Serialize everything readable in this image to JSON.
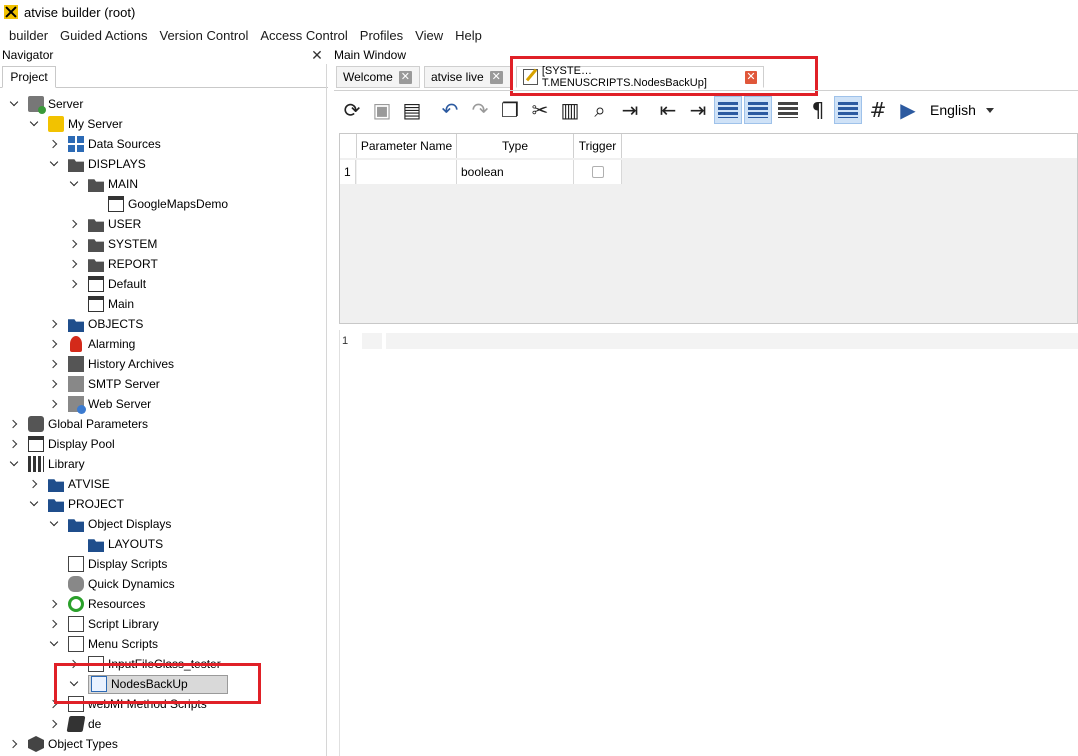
{
  "app": {
    "title": "atvise builder  (root)",
    "menu": [
      "builder",
      "Guided Actions",
      "Version Control",
      "Access Control",
      "Profiles",
      "View",
      "Help"
    ]
  },
  "navigator": {
    "header": "Navigator",
    "close_symbol": "✕",
    "tab": "Project",
    "tree": [
      {
        "label": "Server",
        "icon": "server-icon",
        "level": 0,
        "state": "expanded"
      },
      {
        "label": "My Server",
        "icon": "my-server-icon",
        "level": 1,
        "state": "expanded"
      },
      {
        "label": "Data Sources",
        "icon": "grid-icon",
        "level": 2,
        "state": "collapsed"
      },
      {
        "label": "DISPLAYS",
        "icon": "folder-dark-icon",
        "level": 2,
        "state": "expanded"
      },
      {
        "label": "MAIN",
        "icon": "folder-dark-icon",
        "level": 3,
        "state": "expanded"
      },
      {
        "label": "GoogleMapsDemo",
        "icon": "window-icon",
        "level": 4,
        "state": "leaf"
      },
      {
        "label": "USER",
        "icon": "folder-dark-icon",
        "level": 3,
        "state": "collapsed"
      },
      {
        "label": "SYSTEM",
        "icon": "folder-dark-icon",
        "level": 3,
        "state": "collapsed"
      },
      {
        "label": "REPORT",
        "icon": "folder-dark-icon",
        "level": 3,
        "state": "collapsed"
      },
      {
        "label": "Default",
        "icon": "window-icon",
        "level": 3,
        "state": "collapsed"
      },
      {
        "label": "Main",
        "icon": "window-icon",
        "level": 3,
        "state": "leaf"
      },
      {
        "label": "OBJECTS",
        "icon": "folder-icon",
        "level": 2,
        "state": "collapsed"
      },
      {
        "label": "Alarming",
        "icon": "bell-icon",
        "level": 2,
        "state": "collapsed"
      },
      {
        "label": "History Archives",
        "icon": "archive-icon",
        "level": 2,
        "state": "collapsed"
      },
      {
        "label": "SMTP Server",
        "icon": "mail-server-icon",
        "level": 2,
        "state": "collapsed"
      },
      {
        "label": "Web Server",
        "icon": "web-server-icon",
        "level": 2,
        "state": "collapsed"
      },
      {
        "label": "Global Parameters",
        "icon": "gear-icon",
        "level": 0,
        "state": "collapsed"
      },
      {
        "label": "Display Pool",
        "icon": "window-icon",
        "level": 0,
        "state": "collapsed"
      },
      {
        "label": "Library",
        "icon": "books-icon",
        "level": 0,
        "state": "expanded"
      },
      {
        "label": "ATVISE",
        "icon": "folder-icon",
        "level": 1,
        "state": "collapsed"
      },
      {
        "label": "PROJECT",
        "icon": "folder-icon",
        "level": 1,
        "state": "expanded"
      },
      {
        "label": "Object Displays",
        "icon": "folder-icon",
        "level": 2,
        "state": "expanded"
      },
      {
        "label": "LAYOUTS",
        "icon": "folder-icon",
        "level": 3,
        "state": "leaf"
      },
      {
        "label": "Display Scripts",
        "icon": "script-icon",
        "level": 2,
        "state": "leaf"
      },
      {
        "label": "Quick Dynamics",
        "icon": "cylinder-icon",
        "level": 2,
        "state": "leaf"
      },
      {
        "label": "Resources",
        "icon": "swirl-icon",
        "level": 2,
        "state": "collapsed"
      },
      {
        "label": "Script Library",
        "icon": "doc-icon",
        "level": 2,
        "state": "collapsed"
      },
      {
        "label": "Menu Scripts",
        "icon": "script-icon",
        "level": 2,
        "state": "expanded"
      },
      {
        "label": "InputFileClass_tester",
        "icon": "doc-icon",
        "level": 3,
        "state": "collapsed"
      },
      {
        "label": "NodesBackUp",
        "icon": "doc-blue-icon",
        "level": 3,
        "state": "expanded",
        "selected": true
      },
      {
        "label": "webMI Method Scripts",
        "icon": "script-icon",
        "level": 2,
        "state": "collapsed"
      },
      {
        "label": "de",
        "icon": "book-icon",
        "level": 2,
        "state": "collapsed"
      },
      {
        "label": "Object Types",
        "icon": "cube-icon",
        "level": 0,
        "state": "collapsed"
      }
    ]
  },
  "main": {
    "header": "Main Window",
    "tabs": [
      {
        "label": "Welcome",
        "active": false
      },
      {
        "label": "atvise live",
        "active": false
      },
      {
        "label": "[SYSTE…T.MENUSCRIPTS.NodesBackUp]",
        "active": true
      }
    ],
    "tab_close_symbol": "✕",
    "toolbar": {
      "language": "English"
    },
    "param_table": {
      "columns": [
        "Parameter Name",
        "Type",
        "Trigger"
      ],
      "rows": [
        {
          "num": "1",
          "name": "",
          "type": "boolean",
          "trigger": false
        }
      ]
    },
    "editor": {
      "line_number": "1",
      "content": ""
    }
  },
  "colors": {
    "highlight": "#e02027",
    "folder_blue": "#1f4e8c",
    "accent_blue": "#2c5aa0"
  }
}
